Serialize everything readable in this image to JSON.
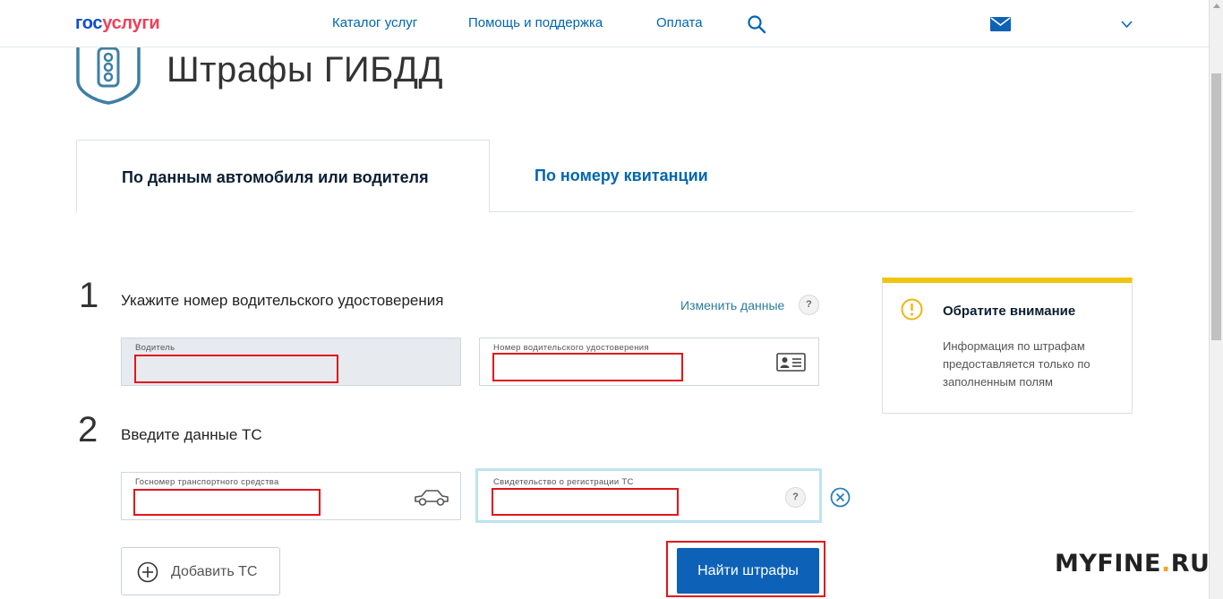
{
  "header": {
    "logo_part1": "гос",
    "logo_part2": "услуги",
    "nav": [
      "Каталог услуг",
      "Помощь и поддержка",
      "Оплата"
    ]
  },
  "page": {
    "title": "Штрафы ГИБДД"
  },
  "tabs": {
    "active": "По данным автомобиля или водителя",
    "inactive": "По номеру квитанции"
  },
  "step1": {
    "number": "1",
    "label": "Укажите номер водительского удостоверения",
    "change_link": "Изменить данные",
    "help": "?",
    "driver_label": "Водитель",
    "license_label": "Номер водительского удостоверения"
  },
  "step2": {
    "number": "2",
    "label": "Введите данные ТС",
    "plate_label": "Госномер транспортного средства",
    "cert_label": "Свидетельство о регистрации ТС",
    "help": "?"
  },
  "notice": {
    "title": "Обратите внимание",
    "text": "Информация по штрафам предоставляется только по заполненным полям"
  },
  "actions": {
    "add_vehicle": "Добавить ТС",
    "search": "Найти штрафы"
  },
  "watermark": {
    "left": "MYFINE",
    "dot": ".",
    "right": "RU"
  },
  "colors": {
    "link": "#0065b1",
    "button": "#0d62b8",
    "highlight": "#e2161a",
    "notice_accent": "#f1c40f"
  }
}
